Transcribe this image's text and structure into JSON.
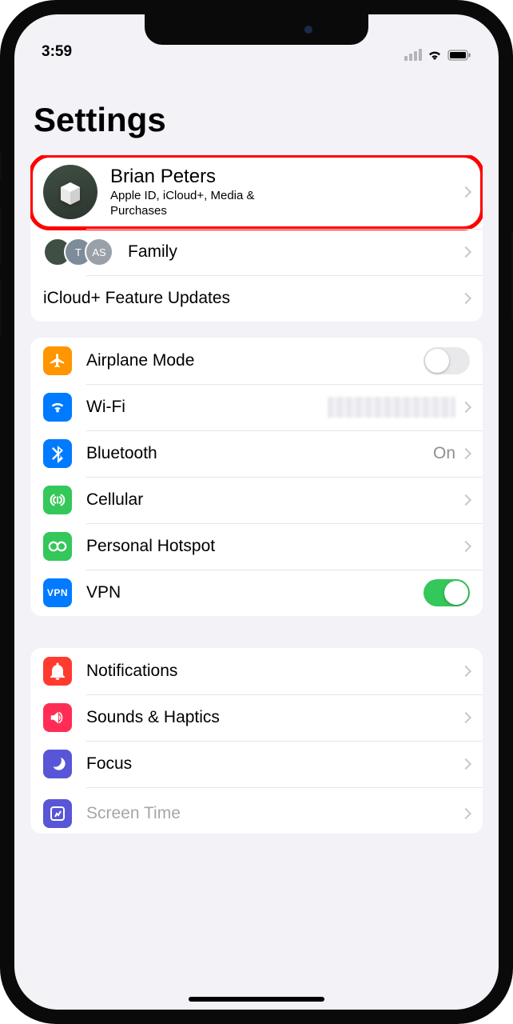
{
  "statusbar": {
    "time": "3:59"
  },
  "title": "Settings",
  "profile": {
    "name": "Brian Peters",
    "subtitle": "Apple ID, iCloud+, Media & Purchases"
  },
  "family": {
    "label": "Family",
    "initials": [
      "",
      "T",
      "AS"
    ]
  },
  "icloud_updates": {
    "label": "iCloud+ Feature Updates"
  },
  "network": {
    "airplane": {
      "label": "Airplane Mode",
      "on": false
    },
    "wifi": {
      "label": "Wi-Fi"
    },
    "bluetooth": {
      "label": "Bluetooth",
      "detail": "On"
    },
    "cellular": {
      "label": "Cellular"
    },
    "hotspot": {
      "label": "Personal Hotspot"
    },
    "vpn": {
      "label": "VPN",
      "badge": "VPN",
      "on": true
    }
  },
  "system": {
    "notifications": {
      "label": "Notifications"
    },
    "sounds": {
      "label": "Sounds & Haptics"
    },
    "focus": {
      "label": "Focus"
    },
    "screentime": {
      "label": "Screen Time"
    }
  },
  "colors": {
    "orange": "#ff9500",
    "blue": "#007aff",
    "green": "#34c759",
    "red": "#ff3b30",
    "pink": "#ff2d55",
    "indigo": "#5856d6",
    "grey": "#8e8e93"
  }
}
